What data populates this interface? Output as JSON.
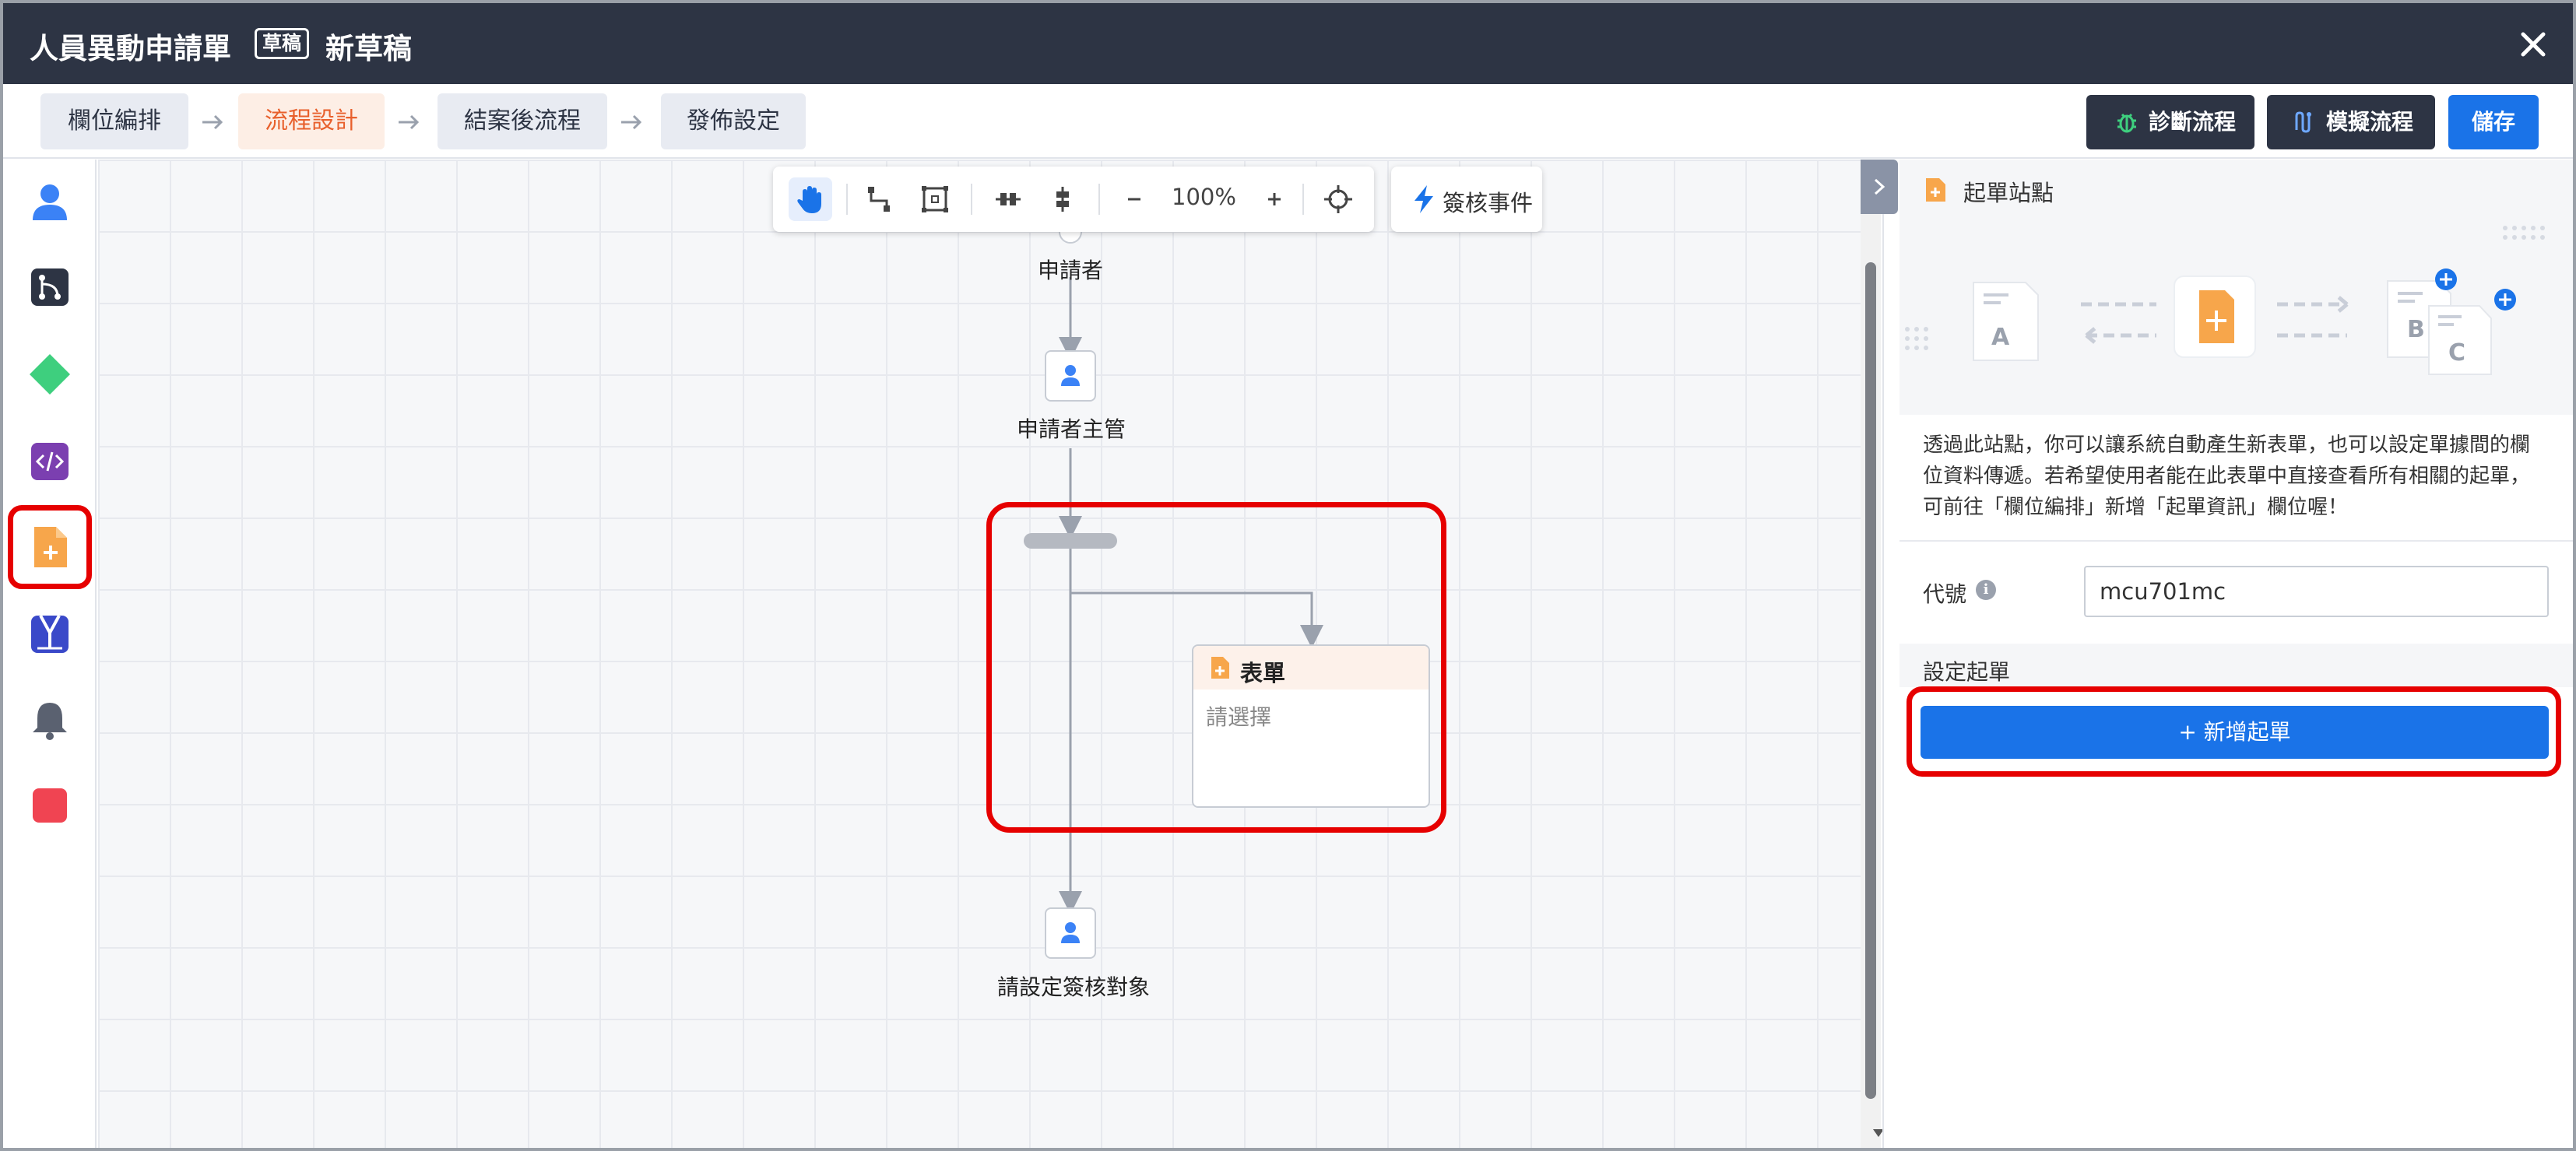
{
  "window": {
    "title": "人員異動申請單",
    "badge": "草稿",
    "subtitle": "新草稿",
    "close_icon": "close-icon"
  },
  "steps": [
    {
      "label": "欄位編排",
      "active": false
    },
    {
      "label": "流程設計",
      "active": true
    },
    {
      "label": "結案後流程",
      "active": false
    },
    {
      "label": "發佈設定",
      "active": false
    }
  ],
  "header_buttons": {
    "diagnose": "診斷流程",
    "simulate": "模擬流程",
    "save": "儲存"
  },
  "palette": [
    {
      "icon": "user-icon",
      "color": "#3b82f6"
    },
    {
      "icon": "branch-icon",
      "color": "#2d3444"
    },
    {
      "icon": "diamond-icon",
      "color": "#3ecf7e"
    },
    {
      "icon": "code-icon",
      "color": "#7b3fb0"
    },
    {
      "icon": "form-add-icon",
      "color": "#f7a64b",
      "selected": true
    },
    {
      "icon": "signer-icon",
      "color": "#3a49c9"
    },
    {
      "icon": "bell-icon",
      "color": "#5a6170"
    },
    {
      "icon": "stop-icon",
      "color": "#f04452"
    }
  ],
  "toolbar": {
    "zoom": "100%",
    "event_label": "簽核事件",
    "tools": [
      "hand-icon",
      "connector-icon",
      "select-frame-icon",
      "align-horizontal-icon",
      "align-vertical-icon",
      "zoom-out-icon",
      "zoom-in-icon",
      "crosshair-icon"
    ]
  },
  "flow": {
    "start_label": "申請者",
    "manager_label": "申請者主管",
    "form_node": {
      "title": "表單",
      "placeholder": "請選擇"
    },
    "end_label": "請設定簽核對象"
  },
  "panel": {
    "title": "起單站點",
    "illustration_letters": [
      "A",
      "B",
      "C"
    ],
    "description": "透過此站點，你可以讓系統自動產生新表單，也可以設定單據間的欄位資料傳遞。若希望使用者能在此表單中直接查看所有相關的起單，可前往「欄位編排」新增「起單資訊」欄位喔！",
    "code_label": "代號",
    "code_value": "mcu701mc",
    "set_section_label": "設定起單",
    "add_button": "+ 新增起單"
  },
  "colors": {
    "titlebar": "#2d3444",
    "accent": "#1a73e8",
    "active_step": "#e8602c",
    "highlight": "#e60000"
  }
}
